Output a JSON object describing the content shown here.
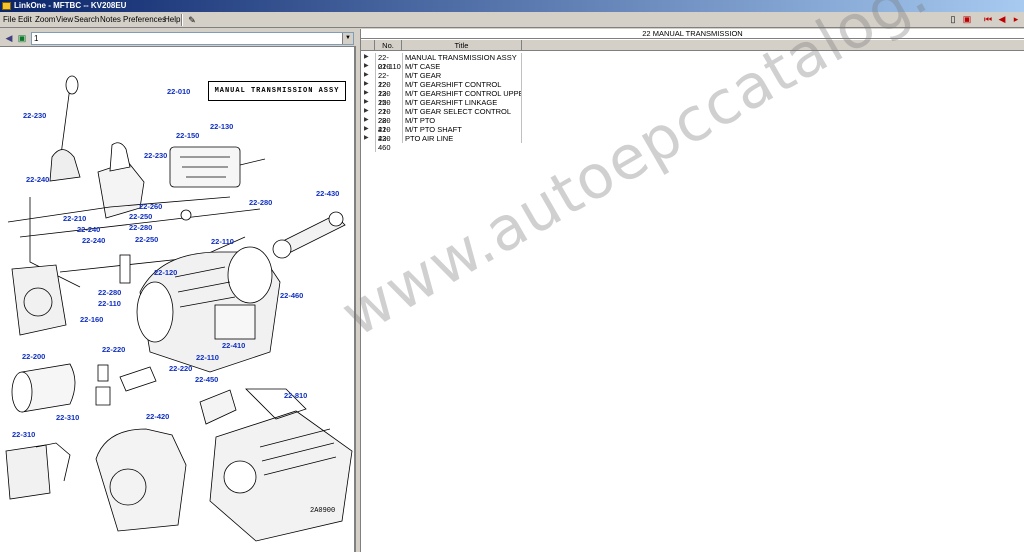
{
  "window": {
    "title": "LinkOne - MFTBC -- KV208EU"
  },
  "menu": [
    "File",
    "Edit",
    "Zoom",
    "View",
    "Search",
    "Notes",
    "Preferences",
    "Help"
  ],
  "left_toolbar": {
    "combo_value": "1"
  },
  "diagram": {
    "assembly_title": "MANUAL TRANSMISSION ASSY",
    "drawing_id": "2A0900",
    "labels": [
      "22-010",
      "22-230",
      "22-130",
      "22-150",
      "22-230",
      "22-240",
      "22-260",
      "22-210",
      "22-250",
      "22-280",
      "22-240",
      "22-280",
      "22-240",
      "22-250",
      "22-430",
      "22-110",
      "22-120",
      "22-280",
      "22-110",
      "22-460",
      "22-160",
      "22-410",
      "22-110",
      "22-200",
      "22-220",
      "22-220",
      "22-450",
      "22-810",
      "22-310",
      "22-420",
      "22-310"
    ]
  },
  "parts_list": {
    "title": "22 MANUAL TRANSMISSION",
    "columns": {
      "no": "No.",
      "title": "Title"
    },
    "rows": [
      {
        "no": "22-010",
        "title": "MANUAL TRANSMISSION ASSY"
      },
      {
        "no": "22-110",
        "title": "M/T CASE"
      },
      {
        "no": "22-120",
        "title": "M/T GEAR"
      },
      {
        "no": "22-130",
        "title": "M/T GEARSHIFT CONTROL"
      },
      {
        "no": "22-150",
        "title": "M/T GEARSHIFT CONTROL UPPER"
      },
      {
        "no": "22-210",
        "title": "M/T GEARSHIFT LINKAGE"
      },
      {
        "no": "22-280",
        "title": "M/T GEAR SELECT CONTROL"
      },
      {
        "no": "22-410",
        "title": "M/T PTO"
      },
      {
        "no": "22-430",
        "title": "M/T PTO SHAFT"
      },
      {
        "no": "22-460",
        "title": "PTO AIR LINE"
      }
    ]
  },
  "watermark": "www.autoepccatalog.com",
  "colors": {
    "titlebar": "#0a246a",
    "label_blue": "#1030c0",
    "chrome": "#d4d0c8"
  }
}
